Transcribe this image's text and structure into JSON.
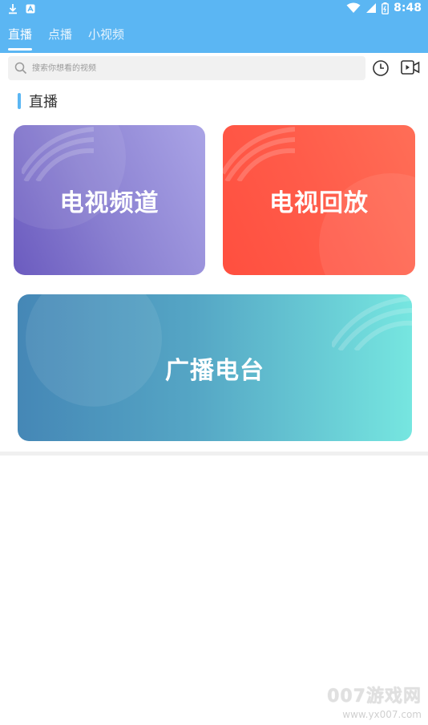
{
  "status_bar": {
    "time": "8:48",
    "left_icons": [
      "download-icon",
      "notification-a-icon"
    ],
    "right_icons": [
      "wifi-icon",
      "signal-icon",
      "battery-icon"
    ]
  },
  "tabs": [
    {
      "label": "直播",
      "active": true
    },
    {
      "label": "点播",
      "active": false
    },
    {
      "label": "小视频",
      "active": false
    }
  ],
  "search": {
    "placeholder": "搜索你想看的视频"
  },
  "toolbar": {
    "history_icon": "clock-icon",
    "video_icon": "video-camera-icon"
  },
  "section": {
    "title": "直播"
  },
  "cards": {
    "tv_channels": "电视频道",
    "tv_replay": "电视回放",
    "radio": "广播电台"
  },
  "colors": {
    "accent": "#5bb6f3",
    "card_tv": [
      "#6b5bbf",
      "#aaa4e6"
    ],
    "card_replay": [
      "#ff4f3f",
      "#ff6e57"
    ],
    "card_radio": [
      "#4587b6",
      "#76e6e0"
    ]
  },
  "watermark": {
    "main": "007游戏网",
    "url": "www.yx007.com"
  }
}
